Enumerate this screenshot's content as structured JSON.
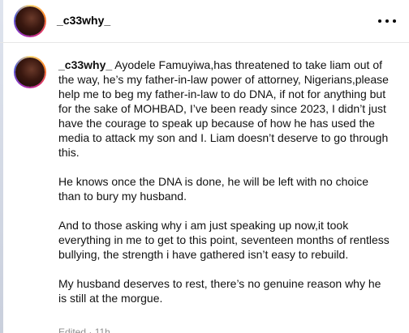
{
  "post": {
    "username": "_c33why_"
  },
  "caption": {
    "username": "_c33why_",
    "paragraphs": [
      "Ayodele Famuyiwa,has threatened to take liam out of the way, he’s my father-in-law power of attorney, Nigerians,please help me to beg my father-in-law to do DNA, if not for anything but for the sake of MOHBAD, I’ve been ready since 2023, I didn’t just have the courage to speak up because of how he has used the media to attack my son and I. Liam doesn’t deserve to go through this.",
      "He knows once the DNA is done, he will be left with no choice than to bury my husband.",
      "And to those asking why i am just speaking up now,it took everything in me to get to this point, seventeen months of rentless bullying, the strength i have gathered isn’t easy to rebuild.",
      "My husband deserves to rest, there’s no genuine reason why he is still at the morgue."
    ]
  },
  "meta": {
    "edited": "Edited · 11h"
  },
  "icons": {
    "more": "more-options-icon"
  }
}
